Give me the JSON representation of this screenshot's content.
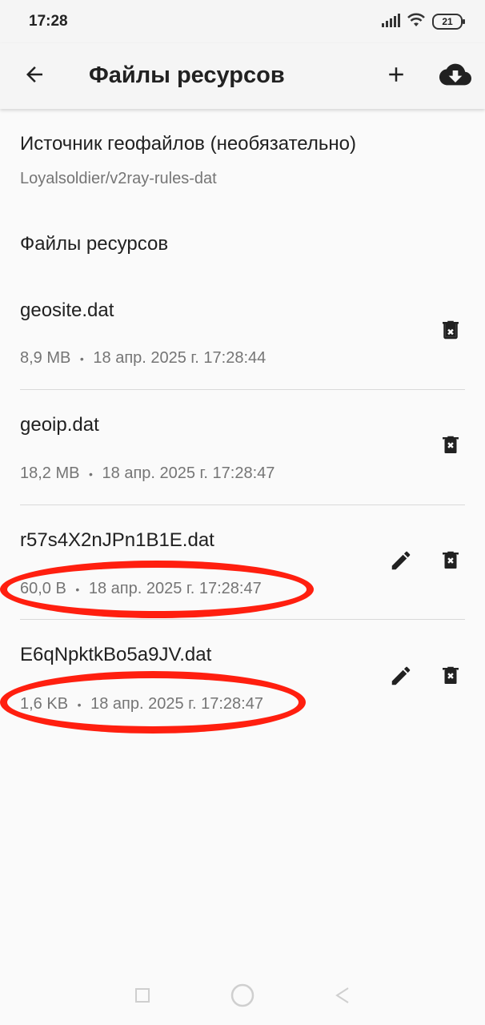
{
  "status_bar": {
    "time": "17:28",
    "battery": "21",
    "icons": [
      "signal-icon",
      "wifi-icon",
      "battery-icon"
    ]
  },
  "app_bar": {
    "title": "Файлы ресурсов",
    "back_icon": "arrow-left-icon",
    "add_icon": "plus-icon",
    "download_icon": "cloud-download-icon"
  },
  "geofiles_source": {
    "title": "Источник геофайлов (необязательно)",
    "value": "Loyalsoldier/v2ray-rules-dat"
  },
  "section_title": "Файлы ресурсов",
  "files": [
    {
      "name": "geosite.dat",
      "size": "8,9 MB",
      "separator": "•",
      "date": "18 апр. 2025 г. 17:28:44",
      "editable": false,
      "highlighted": false
    },
    {
      "name": "geoip.dat",
      "size": "18,2 MB",
      "separator": "•",
      "date": "18 апр. 2025 г. 17:28:47",
      "editable": false,
      "highlighted": false
    },
    {
      "name": "r57s4X2nJPn1B1E.dat",
      "size": "60,0 B",
      "separator": "•",
      "date": "18 апр. 2025 г. 17:28:47",
      "editable": true,
      "highlighted": true
    },
    {
      "name": "E6qNpktkBo5a9JV.dat",
      "size": "1,6 KB",
      "separator": "•",
      "date": "18 апр. 2025 г. 17:28:47",
      "editable": true,
      "highlighted": true
    }
  ],
  "annotation_color": "#ff1f0f",
  "nav_bar": [
    "recent-apps-icon",
    "home-icon",
    "back-icon"
  ]
}
